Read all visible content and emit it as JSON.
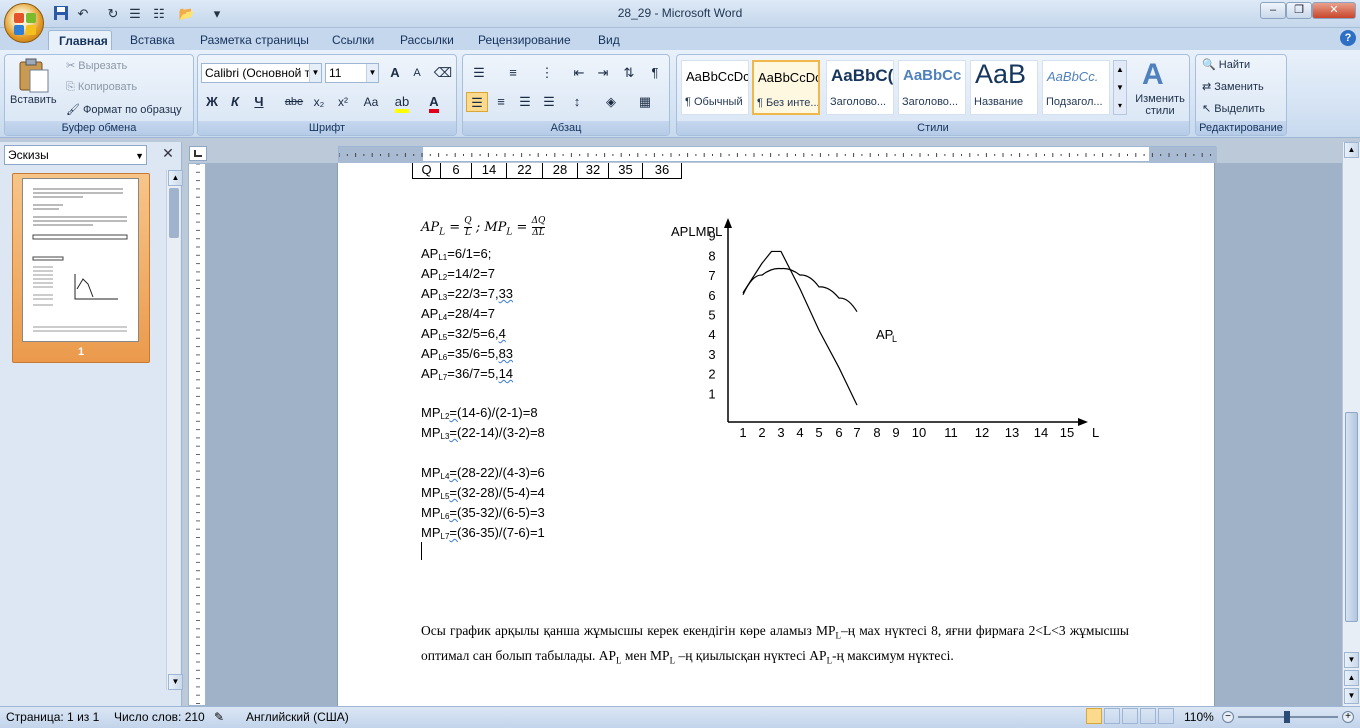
{
  "window": {
    "title": "28_29 - Microsoft Word",
    "minimize": "–",
    "maximize": "❐",
    "close": "✕",
    "help": "?"
  },
  "quick_access": {
    "save_icon": "save-icon",
    "undo": "↶",
    "redo": "↻",
    "customize": "▾"
  },
  "tabs": [
    "Главная",
    "Вставка",
    "Разметка страницы",
    "Ссылки",
    "Рассылки",
    "Рецензирование",
    "Вид"
  ],
  "ribbon": {
    "clipboard": {
      "label": "Буфер обмена",
      "paste": "Вставить",
      "cut": "Вырезать",
      "copy": "Копировать",
      "format_painter": "Формат по образцу"
    },
    "font": {
      "label": "Шрифт",
      "font_name": "Calibri (Основной те",
      "font_size": "11",
      "bold": "Ж",
      "italic": "К",
      "underline": "Ч",
      "strike": "abe",
      "sub": "x₂",
      "sup": "x²",
      "case": "Aa",
      "grow": "A",
      "shrink": "A"
    },
    "paragraph": {
      "label": "Абзац"
    },
    "styles": {
      "label": "Стили",
      "items": [
        {
          "preview": "AaBbCcDc",
          "name": "¶ Обычный"
        },
        {
          "preview": "AaBbCcDc",
          "name": "¶ Без инте..."
        },
        {
          "preview": "AaBbC(",
          "name": "Заголово..."
        },
        {
          "preview": "AaBbCc",
          "name": "Заголово..."
        },
        {
          "preview": "AaB",
          "name": "Название"
        },
        {
          "preview": "AaBbCc.",
          "name": "Подзагол..."
        }
      ],
      "change_styles": "Изменить стили"
    },
    "editing": {
      "label": "Редактирование",
      "find": "Найти",
      "replace": "Заменить",
      "select": "Выделить"
    }
  },
  "nav_pane": {
    "view": "Эскизы",
    "page_number": "1"
  },
  "document": {
    "table_row": [
      "Q",
      "6",
      "14",
      "22",
      "28",
      "32",
      "35",
      "36"
    ],
    "formula": "APL = Q/L ; MPL = ΔQ/ΔL",
    "ap_lines": [
      {
        "pre": "AP",
        "sub": "L1",
        "post": "=6/1=6;",
        "ul": ""
      },
      {
        "pre": "AP",
        "sub": "L2",
        "post": "=14/2=7",
        "ul": ""
      },
      {
        "pre": "AP",
        "sub": "L3",
        "post": "=22/3=7,",
        "ul": "33"
      },
      {
        "pre": "AP",
        "sub": "L4",
        "post": "=28/4=7",
        "ul": ""
      },
      {
        "pre": "AP",
        "sub": "L5",
        "post": "=32/5=6,",
        "ul": "4"
      },
      {
        "pre": "AP",
        "sub": "L6",
        "post": "=35/6=5,",
        "ul": "83"
      },
      {
        "pre": "AP",
        "sub": "L7",
        "post": "=36/7=5,",
        "ul": "14"
      }
    ],
    "mp_lines_a": [
      {
        "pre": "MP",
        "sub": "L2",
        "ul": "=(",
        "post": "14-6)/(2-1)=8"
      },
      {
        "pre": "MP",
        "sub": "L3",
        "ul": "=(",
        "post": "22-14)/(3-2)=8"
      }
    ],
    "mp_lines_b": [
      {
        "pre": "MP",
        "sub": "L4",
        "ul": "=(",
        "post": "28-22)/(4-3)=6"
      },
      {
        "pre": "MP",
        "sub": "L5",
        "ul": "=(",
        "post": "32-28)/(5-4)=4"
      },
      {
        "pre": "MP",
        "sub": "L6",
        "ul": "=(",
        "post": "35-32)/(6-5)=3"
      },
      {
        "pre": "MP",
        "sub": "L7",
        "ul": "=(",
        "post": "36-35)/(7-6)=1"
      }
    ],
    "paragraph": "Осы график арқылы қанша жұмысшы керек екендігін көре аламыз MPL–ң мах нүктесі 8, яғни фирмаға 2<L<3 жұмысшы оптимал сан болып табылады. APL мен MPL –ң қиылысқан нүктесі APL-ң максимум нүктесі."
  },
  "chart_data": {
    "type": "line",
    "ylabel": "APLMPL",
    "xlabel": "L",
    "x_ticks": [
      "1",
      "2",
      "3",
      "4",
      "5",
      "6",
      "7",
      "8",
      "9",
      "10",
      "11",
      "12",
      "13",
      "14",
      "15"
    ],
    "y_ticks": [
      "1",
      "2",
      "3",
      "4",
      "5",
      "6",
      "7",
      "8",
      "9"
    ],
    "series": [
      {
        "name": "APL",
        "x": [
          1,
          2,
          3,
          4,
          5,
          6,
          7
        ],
        "y": [
          6,
          7,
          7.33,
          7,
          6.4,
          5.83,
          5.14
        ]
      },
      {
        "name": "",
        "x": [
          1,
          2,
          2.5,
          3,
          4,
          5,
          6,
          7
        ],
        "y": [
          6.1,
          7.6,
          8.2,
          8.2,
          6.3,
          4.2,
          2.3,
          0.4
        ]
      }
    ],
    "grid": false
  },
  "status": {
    "page": "Страница: 1 из 1",
    "words": "Число слов: 210",
    "lang": "Английский (США)",
    "zoom": "110%"
  },
  "colors": {
    "ribbon": "#dbe6f4",
    "accent": "#15325c",
    "selected_style": "#f0b84a"
  }
}
